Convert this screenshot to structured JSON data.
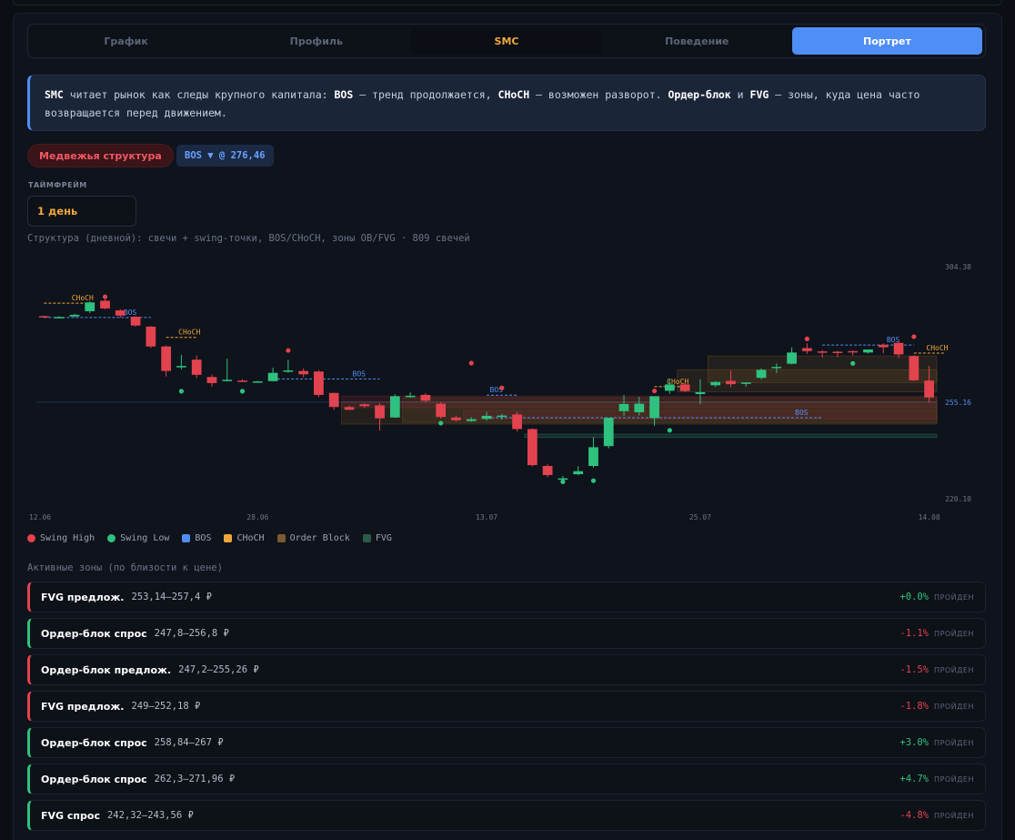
{
  "tabs": [
    "График",
    "Профиль",
    "SMC",
    "Поведение",
    "Портрет"
  ],
  "info": {
    "smc": "SMC",
    "t1": " читает рынок как следы крупного капитала: ",
    "bos": "BOS",
    "t2": " — тренд продолжается, ",
    "choch": "CHoCH",
    "t3": " — возможен разворот. ",
    "ob": "Ордер-блок",
    "t4": " и ",
    "fvg": "FVG",
    "t5": " — зоны, куда цена часто возвращается перед движением."
  },
  "structure_badge": "Медвежья структура",
  "bos_badge": "BOS ▼ @ 276,46",
  "timeframe": {
    "label": "ТАЙМФРЕЙМ",
    "value": "1 день"
  },
  "caption": "Структура (дневной): свечи + swing-точки, BOS/CHoCH, зоны OB/FVG · 809 свечей",
  "chart_data": {
    "type": "candlestick",
    "x_ticks": [
      "12.06",
      "28.06",
      "13.07",
      "25.07",
      "14.08"
    ],
    "y_ticks": [
      "304.38",
      "255.16",
      "220.10"
    ],
    "ylim": [
      220.1,
      304.38
    ],
    "current_price": 255.16,
    "candles": [
      [
        286.4,
        286.6,
        286.0,
        286.2
      ],
      [
        286.0,
        286.4,
        285.8,
        286.1
      ],
      [
        286.3,
        287.3,
        286.1,
        286.9
      ],
      [
        288.2,
        291.8,
        287.5,
        291.4
      ],
      [
        292.0,
        292.5,
        288.9,
        289.2
      ],
      [
        288.5,
        289.0,
        285.9,
        286.6
      ],
      [
        286.2,
        286.4,
        282.6,
        283.0
      ],
      [
        282.6,
        282.8,
        274.8,
        275.4
      ],
      [
        275.4,
        275.8,
        264.5,
        266.5
      ],
      [
        268.2,
        272.3,
        267.1,
        268.3
      ],
      [
        270.6,
        272.1,
        263.9,
        265.1
      ],
      [
        264.3,
        265.2,
        260.8,
        262.1
      ],
      [
        263.1,
        271.0,
        262.7,
        263.3
      ],
      [
        263.0,
        263.5,
        262.5,
        262.9
      ],
      [
        262.6,
        262.9,
        262.5,
        262.7
      ],
      [
        262.8,
        267.7,
        262.7,
        265.8
      ],
      [
        266.3,
        270.5,
        265.9,
        266.7
      ],
      [
        266.5,
        267.4,
        264.2,
        265.3
      ],
      [
        266.3,
        266.8,
        257.0,
        257.8
      ],
      [
        258.5,
        258.6,
        252.4,
        253.4
      ],
      [
        253.4,
        253.9,
        252.3,
        252.4
      ],
      [
        254.4,
        254.7,
        253.1,
        253.7
      ],
      [
        254.0,
        254.8,
        244.9,
        249.3
      ],
      [
        249.6,
        258.0,
        249.4,
        257.3
      ],
      [
        257.5,
        258.7,
        256.8,
        257.5
      ],
      [
        257.8,
        258.4,
        255.1,
        255.7
      ],
      [
        254.6,
        255.3,
        249.2,
        249.8
      ],
      [
        249.6,
        250.2,
        248.1,
        248.6
      ],
      [
        248.3,
        249.7,
        248.0,
        249.0
      ],
      [
        249.1,
        251.6,
        248.4,
        250.2
      ],
      [
        249.8,
        250.9,
        248.8,
        250.3
      ],
      [
        250.7,
        251.7,
        244.5,
        245.4
      ],
      [
        245.4,
        245.6,
        231.8,
        232.3
      ],
      [
        232.0,
        232.6,
        227.9,
        228.7
      ],
      [
        227.4,
        228.4,
        226.5,
        227.5
      ],
      [
        229.0,
        231.9,
        228.6,
        230.1
      ],
      [
        232.0,
        242.4,
        231.4,
        238.8
      ],
      [
        239.2,
        248.7,
        238.4,
        249.5
      ],
      [
        251.9,
        257.7,
        250.2,
        254.5
      ],
      [
        251.5,
        257.1,
        250.3,
        254.6
      ],
      [
        249.4,
        256.7,
        246.6,
        257.3
      ],
      [
        259.3,
        263.7,
        258.2,
        261.6
      ],
      [
        261.6,
        262.1,
        258.8,
        259.2
      ],
      [
        258.1,
        263.5,
        254.4,
        258.8
      ],
      [
        261.3,
        262.8,
        260.7,
        262.5
      ],
      [
        262.9,
        266.6,
        260.6,
        261.7
      ],
      [
        261.9,
        262.4,
        260.8,
        262.3
      ],
      [
        264.0,
        267.4,
        263.5,
        266.9
      ],
      [
        267.6,
        269.2,
        265.8,
        268.0
      ],
      [
        269.1,
        275.1,
        268.9,
        273.2
      ],
      [
        274.8,
        276.5,
        272.7,
        273.7
      ],
      [
        273.6,
        274.1,
        271.3,
        273.3
      ],
      [
        273.5,
        273.8,
        271.5,
        273.0
      ],
      [
        273.7,
        273.9,
        272.2,
        273.4
      ],
      [
        273.2,
        274.3,
        272.8,
        274.3
      ],
      [
        276.0,
        276.5,
        272.9,
        275.1
      ],
      [
        276.7,
        277.3,
        271.1,
        272.5
      ],
      [
        271.9,
        272.2,
        262.9,
        263.1
      ],
      [
        263.0,
        268.4,
        255.0,
        256.9
      ]
    ],
    "swing_highs": [
      291.8,
      272.3,
      267.7,
      258.7,
      257.6,
      276.5,
      277.3
    ],
    "swing_lows": [
      260.8,
      260.8,
      249.2,
      227.9,
      228.3,
      246.6,
      270.9
    ],
    "bos_levels": [
      285.9,
      263.6,
      257.7,
      249.5,
      275.9
    ],
    "choch_levels": [
      291.1,
      278.7,
      260.8,
      273.0
    ],
    "order_blocks": [
      [
        247.8,
        256.8
      ],
      [
        247.2,
        255.26
      ],
      [
        258.84,
        267
      ],
      [
        262.3,
        271.96
      ]
    ],
    "fvg": [
      [
        253.14,
        257.4
      ],
      [
        249,
        252.18
      ],
      [
        242.32,
        243.56
      ]
    ]
  },
  "legend": {
    "swing_high": "Swing High",
    "swing_low": "Swing Low",
    "bos": "BOS",
    "choch": "CHoCH",
    "order_block": "Order Block",
    "fvg": "FVG"
  },
  "chart_labels": {
    "bos": "BOS",
    "choch": "CHoCH"
  },
  "zones_title": "Активные зоны (по близости к цене)",
  "zones": [
    {
      "name": "FVG предлож.",
      "range": "253,14–257,4 ₽",
      "pct": "+0.0%",
      "status": "ПРОЙДЕН",
      "kind": "supply",
      "sign": "pos"
    },
    {
      "name": "Ордер-блок спрос",
      "range": "247,8–256,8 ₽",
      "pct": "-1.1%",
      "status": "ПРОЙДЕН",
      "kind": "demand",
      "sign": "neg"
    },
    {
      "name": "Ордер-блок предлож.",
      "range": "247,2–255,26 ₽",
      "pct": "-1.5%",
      "status": "ПРОЙДЕН",
      "kind": "supply",
      "sign": "neg"
    },
    {
      "name": "FVG предлож.",
      "range": "249–252,18 ₽",
      "pct": "-1.8%",
      "status": "ПРОЙДЕН",
      "kind": "supply",
      "sign": "neg"
    },
    {
      "name": "Ордер-блок спрос",
      "range": "258,84–267 ₽",
      "pct": "+3.0%",
      "status": "ПРОЙДЕН",
      "kind": "demand",
      "sign": "pos"
    },
    {
      "name": "Ордер-блок спрос",
      "range": "262,3–271,96 ₽",
      "pct": "+4.7%",
      "status": "ПРОЙДЕН",
      "kind": "demand",
      "sign": "pos"
    },
    {
      "name": "FVG спрос",
      "range": "242,32–243,56 ₽",
      "pct": "-4.8%",
      "status": "ПРОЙДЕН",
      "kind": "demand",
      "sign": "neg"
    }
  ],
  "colors": {
    "up": "#2ec27e",
    "down": "#e2434f",
    "bos": "#4f8ef7",
    "choch": "#f0a73a",
    "ob": "#6b4a2a",
    "fvg": "#2a5a48",
    "accent": "#4f8ef7"
  }
}
